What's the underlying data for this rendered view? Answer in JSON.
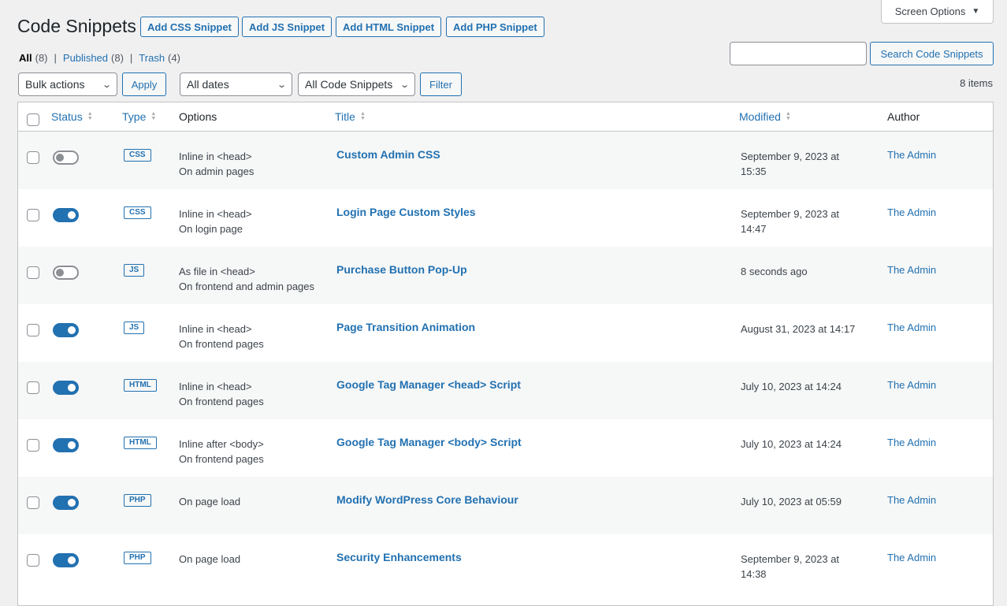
{
  "screen_options": {
    "label": "Screen Options"
  },
  "page_title": "Code Snippets",
  "add_buttons": [
    "Add CSS Snippet",
    "Add JS Snippet",
    "Add HTML Snippet",
    "Add PHP Snippet"
  ],
  "filters": {
    "all_label": "All",
    "all_count": "(8)",
    "published_label": "Published",
    "published_count": "(8)",
    "trash_label": "Trash",
    "trash_count": "(4)",
    "separator": "|"
  },
  "search": {
    "value": "",
    "button_label": "Search Code Snippets"
  },
  "toolbar": {
    "bulk_actions": "Bulk actions",
    "apply_label": "Apply",
    "dates": "All dates",
    "snippet_types": "All Code Snippets",
    "filter_label": "Filter",
    "items_count": "8 items"
  },
  "table": {
    "headers": {
      "status": "Status",
      "type": "Type",
      "options": "Options",
      "title": "Title",
      "modified": "Modified",
      "author": "Author"
    },
    "rows": [
      {
        "active": false,
        "type": "CSS",
        "options_line1": "Inline in <head>",
        "options_line2": "On admin pages",
        "title": "Custom Admin CSS",
        "modified_line1": "September 9, 2023 at",
        "modified_line2": "15:35",
        "author": "The Admin"
      },
      {
        "active": true,
        "type": "CSS",
        "options_line1": "Inline in <head>",
        "options_line2": "On login page",
        "title": "Login Page Custom Styles",
        "modified_line1": "September 9, 2023 at",
        "modified_line2": "14:47",
        "author": "The Admin"
      },
      {
        "active": false,
        "type": "JS",
        "options_line1": "As file in <head>",
        "options_line2": "On frontend and admin pages",
        "title": "Purchase Button Pop-Up",
        "modified_line1": "8 seconds ago",
        "modified_line2": "",
        "author": "The Admin"
      },
      {
        "active": true,
        "type": "JS",
        "options_line1": "Inline in <head>",
        "options_line2": "On frontend pages",
        "title": "Page Transition Animation",
        "modified_line1": "August 31, 2023 at 14:17",
        "modified_line2": "",
        "author": "The Admin"
      },
      {
        "active": true,
        "type": "HTML",
        "options_line1": "Inline in <head>",
        "options_line2": "On frontend pages",
        "title": "Google Tag Manager <head> Script",
        "modified_line1": "July 10, 2023 at 14:24",
        "modified_line2": "",
        "author": "The Admin"
      },
      {
        "active": true,
        "type": "HTML",
        "options_line1": "Inline after <body>",
        "options_line2": "On frontend pages",
        "title": "Google Tag Manager <body> Script",
        "modified_line1": "July 10, 2023 at 14:24",
        "modified_line2": "",
        "author": "The Admin"
      },
      {
        "active": true,
        "type": "PHP",
        "options_line1": "On page load",
        "options_line2": "",
        "title": "Modify WordPress Core Behaviour",
        "modified_line1": "July 10, 2023 at 05:59",
        "modified_line2": "",
        "author": "The Admin"
      },
      {
        "active": true,
        "type": "PHP",
        "options_line1": "On page load",
        "options_line2": "",
        "title": "Security Enhancements",
        "modified_line1": "September 9, 2023 at",
        "modified_line2": "14:38",
        "author": "The Admin"
      }
    ]
  },
  "colors": {
    "link": "#2271b1",
    "toggle_on": "#2271b1",
    "toggle_off": "#8c8f94"
  }
}
